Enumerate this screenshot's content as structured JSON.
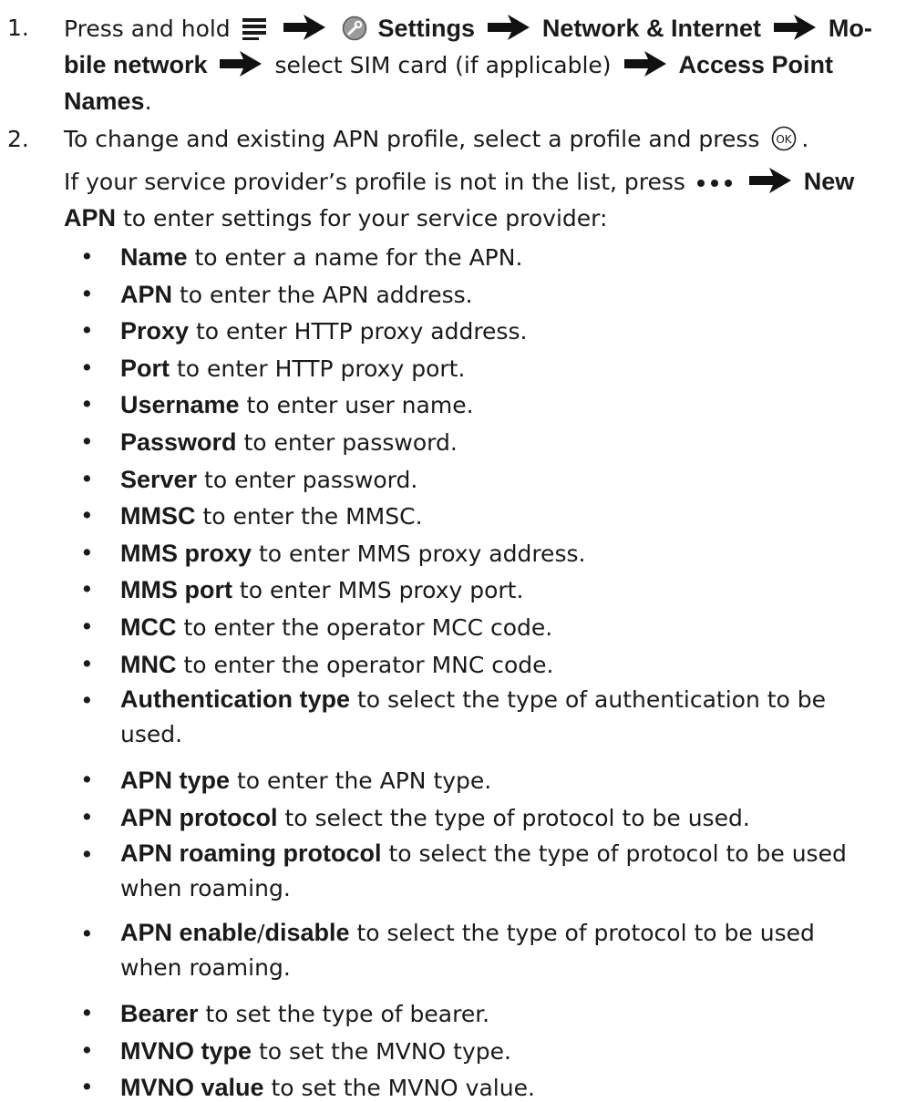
{
  "step1": {
    "number": "1.",
    "t_press_hold": "Press and hold",
    "settings": "Settings",
    "network_internet": "Network & Internet",
    "mo": "Mo-",
    "bile_network": "bile network",
    "select_sim": "select SIM card (if applicable)",
    "access_point": "Access Point",
    "names": "Names",
    "period": "."
  },
  "step2": {
    "number": "2.",
    "line1": "To change and existing APN profile, select a profile and press",
    "line1_end": ".",
    "line2_pre": "If your service provider’s profile is not in the list, press",
    "new": "New",
    "apn_word": "APN",
    "line3_rest": " to enter settings for your service provider:"
  },
  "items": [
    {
      "term": "Name",
      "desc": " to enter a name for the APN."
    },
    {
      "term": "APN",
      "desc": " to enter the APN address."
    },
    {
      "term": "Proxy",
      "desc": " to enter HTTP proxy address."
    },
    {
      "term": "Port",
      "desc": " to enter HTTP proxy port."
    },
    {
      "term": "Username",
      "desc": " to enter user name."
    },
    {
      "term": "Password",
      "desc": " to enter password."
    },
    {
      "term": "Server",
      "desc": " to enter password."
    },
    {
      "term": "MMSC",
      "desc": " to enter the MMSC."
    },
    {
      "term": "MMS proxy",
      "desc": " to enter MMS proxy address."
    },
    {
      "term": "MMS port",
      "desc": " to enter MMS proxy port."
    },
    {
      "term": "MCC",
      "desc": " to enter the operator MCC code."
    },
    {
      "term": "MNC",
      "desc": " to enter the operator MNC code."
    },
    {
      "term": "Authentication type",
      "desc": " to select the type of authentication to be",
      "desc2": "used."
    },
    {
      "term": "APN type",
      "desc": " to enter the APN type."
    },
    {
      "term": "APN protocol",
      "desc": " to select the type of protocol to be used."
    },
    {
      "term": "APN roaming protocol",
      "desc": " to select the type of protocol to be used",
      "desc2": "when roaming."
    },
    {
      "term": "APN enable",
      "slash": "/",
      "term2": "disable",
      "desc": " to select the type of protocol to be used",
      "desc2": "when roaming."
    },
    {
      "term": "Bearer",
      "desc": " to set the type of bearer."
    },
    {
      "term": "MVNO type",
      "desc": " to set the MVNO type."
    },
    {
      "term": "MVNO value",
      "desc": " to set the MVNO value."
    }
  ],
  "bullet_char": "•",
  "icons": [
    "menu-icon",
    "arrow-right-icon",
    "settings-wrench-icon",
    "ok-key-icon",
    "more-dots-icon"
  ]
}
